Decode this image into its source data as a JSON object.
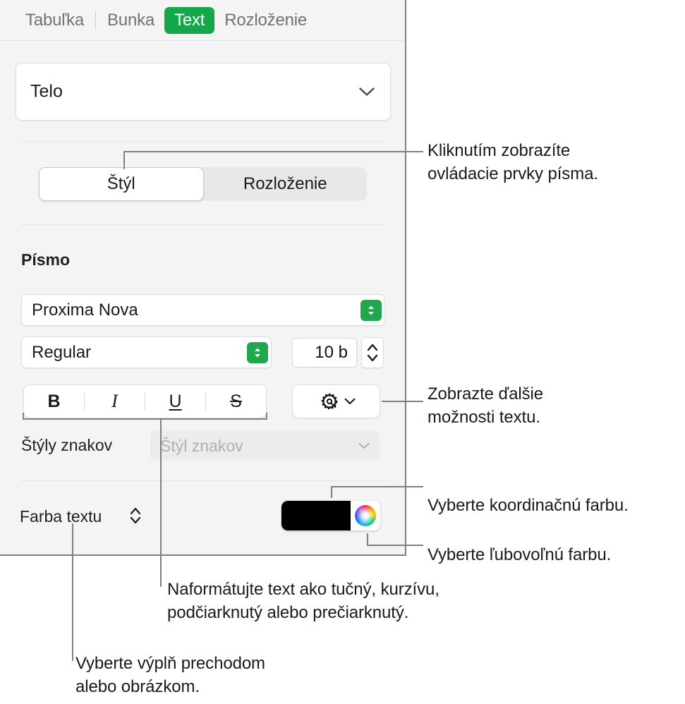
{
  "panel": {
    "tabs": [
      {
        "label": "Tabuľka",
        "active": false
      },
      {
        "label": "Bunka",
        "active": false
      },
      {
        "label": "Text",
        "active": true
      },
      {
        "label": "Rozloženie",
        "active": false
      }
    ],
    "paragraph_style": {
      "value": "Telo",
      "icon": "chevron-down-icon"
    },
    "segmented": {
      "options": [
        "Štýl",
        "Rozloženie"
      ],
      "selected": "Štýl"
    },
    "font_section": {
      "title": "Písmo",
      "family": "Proxima Nova",
      "style": "Regular",
      "size": "10 b",
      "stepper_icon": "up-down-arrows-icon"
    },
    "style_buttons": [
      {
        "name": "bold-button",
        "label": "B"
      },
      {
        "name": "italic-button",
        "label": "I"
      },
      {
        "name": "underline-button",
        "label": "U"
      },
      {
        "name": "strikethrough-button",
        "label": "S"
      }
    ],
    "gear_button": {
      "icon": "gear-icon",
      "chevron": "chevron-down-icon"
    },
    "character_styles": {
      "label": "Štýly znakov",
      "placeholder": "Štýl znakov"
    },
    "text_color": {
      "label": "Farba textu",
      "disclosure_icon": "up-down-arrows-icon",
      "swatch_color": "#000000",
      "wheel_icon": "color-wheel-icon"
    },
    "accent_color": "#14a84b"
  },
  "annotations": {
    "style_toggle": "Kliknutím zobrazíte\novládacie prvky písma.",
    "gear": "Zobrazte ďalšie\nmožnosti textu.",
    "coordinated_color": "Vyberte koordinačnú farbu.",
    "any_color": "Vyberte ľubovoľnú farbu.",
    "formatting": "Naformátujte text ako tučný, kurzívu,\npodčiarknutý alebo prečiarknutý.",
    "fill": "Vyberte výplň prechodom\nalebo obrázkom."
  }
}
